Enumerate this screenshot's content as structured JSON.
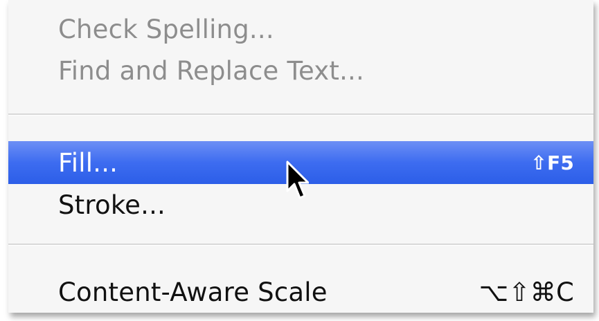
{
  "menu": {
    "items": [
      {
        "label": "Check Spelling...",
        "shortcut": "",
        "enabled": false
      },
      {
        "label": "Find and Replace Text...",
        "shortcut": "",
        "enabled": false
      },
      {
        "label": "Fill...",
        "shortcut": "⇧F5",
        "enabled": true,
        "highlighted": true
      },
      {
        "label": "Stroke...",
        "shortcut": "",
        "enabled": true
      },
      {
        "label": "Content-Aware Scale",
        "shortcut": "⌥⇧⌘C",
        "enabled": true
      }
    ],
    "highlight_color": "#3d6cf0",
    "disabled_color": "#8d8d8d"
  },
  "cursor": {
    "icon": "arrow-pointer-icon"
  }
}
